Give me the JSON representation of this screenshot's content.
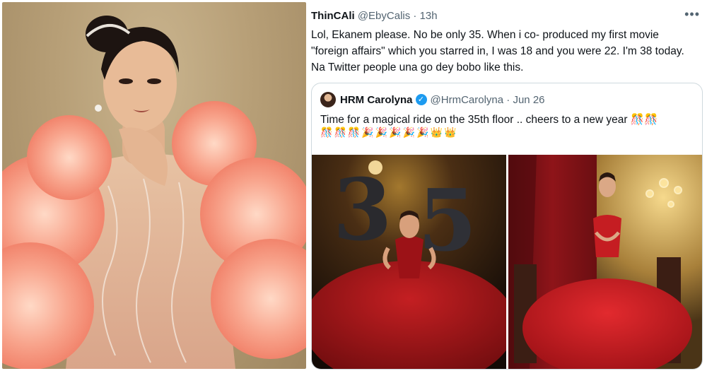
{
  "tweet": {
    "display_name": "ThinCAli",
    "handle": "@EbyCalis",
    "time": "13h",
    "more_icon": "more-horizontal-icon",
    "text": "Lol, Ekanem please. No be only 35. When i co- produced my first movie \"foreign affairs\" which you starred in, I was 18 and you were 22. I'm 38 today. Na Twitter people una go dey bobo like this."
  },
  "quote": {
    "display_name": "HRM Carolyna",
    "handle": "@HrmCarolyna",
    "date": "Jun 26",
    "verified_icon": "verified-badge-icon",
    "text": "Time for a magical ride on the 35th floor .. cheers to a new year",
    "text_emojis": "🎊🎊",
    "emojis": [
      "🎊",
      "🎊",
      "🎊",
      "🎉",
      "🎉",
      "🎉",
      "🎉",
      "🎉",
      "👑",
      "👑"
    ]
  },
  "photos": {
    "left": {
      "balloon_number": "35"
    }
  },
  "colors": {
    "text": "#0f1419",
    "muted": "#536471",
    "border": "#cfd9de",
    "verified": "#1d9bf0",
    "gown_red": "#b01218",
    "ruffle_peach": "#f6907a"
  }
}
